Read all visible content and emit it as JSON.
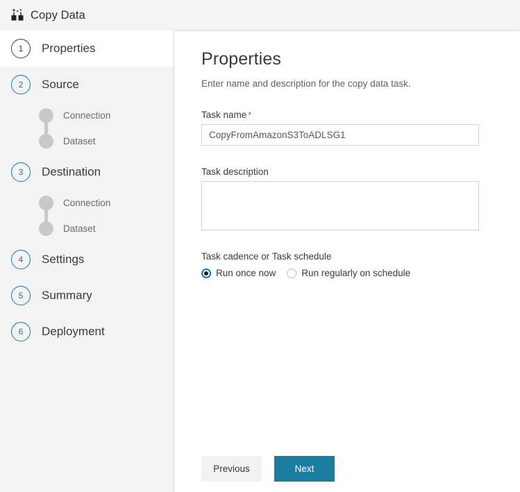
{
  "window": {
    "title": "Copy Data",
    "icon": "copy-data-icon"
  },
  "sidebar": {
    "steps": [
      {
        "number": "1",
        "label": "Properties",
        "active": true,
        "substeps": []
      },
      {
        "number": "2",
        "label": "Source",
        "active": false,
        "substeps": [
          "Connection",
          "Dataset"
        ]
      },
      {
        "number": "3",
        "label": "Destination",
        "active": false,
        "substeps": [
          "Connection",
          "Dataset"
        ]
      },
      {
        "number": "4",
        "label": "Settings",
        "active": false,
        "substeps": []
      },
      {
        "number": "5",
        "label": "Summary",
        "active": false,
        "substeps": []
      },
      {
        "number": "6",
        "label": "Deployment",
        "active": false,
        "substeps": []
      }
    ]
  },
  "main": {
    "title": "Properties",
    "subtitle": "Enter name and description for the copy data task.",
    "task_name": {
      "label": "Task name",
      "required_marker": "*",
      "value": "CopyFromAmazonS3ToADLSG1",
      "placeholder": "Task name"
    },
    "task_description": {
      "label": "Task description",
      "value": "",
      "placeholder": ""
    },
    "cadence": {
      "label": "Task cadence or Task schedule",
      "options": [
        {
          "label": "Run once now",
          "selected": true
        },
        {
          "label": "Run regularly on schedule",
          "selected": false
        }
      ]
    }
  },
  "footer": {
    "previous_label": "Previous",
    "next_label": "Next"
  },
  "colors": {
    "accent": "#1b7ea1",
    "step_teal": "#0f7c9c",
    "required": "#e04e2a",
    "radio_ring": "#0a78b8",
    "rail_bg": "#f3f3f3"
  }
}
